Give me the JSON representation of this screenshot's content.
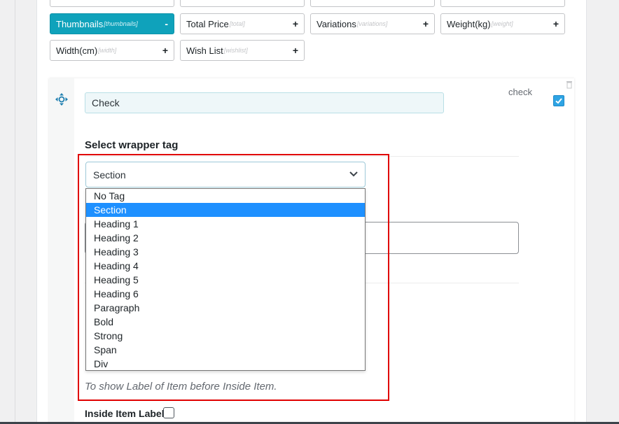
{
  "field_chips": [
    {
      "label": "Thumbnails",
      "key": "[thumbnails]",
      "action": "-",
      "active": true
    },
    {
      "label": "Total Price",
      "key": "[total]",
      "action": "+",
      "active": false
    },
    {
      "label": "Variations",
      "key": "[variations]",
      "action": "+",
      "active": false
    },
    {
      "label": "Weight(kg)",
      "key": "[weight]",
      "action": "+",
      "active": false
    },
    {
      "label": "Width(cm)",
      "key": "[width]",
      "action": "+",
      "active": false
    },
    {
      "label": "Wish List",
      "key": "[wishlist]",
      "action": "+",
      "active": false
    }
  ],
  "item": {
    "title_value": "Check",
    "type_label": "check",
    "enabled": true
  },
  "wrapper": {
    "heading": "Select wrapper tag",
    "selected": "Section",
    "options": [
      "No Tag",
      "Section",
      "Heading 1",
      "Heading 2",
      "Heading 3",
      "Heading 4",
      "Heading 5",
      "Heading 6",
      "Paragraph",
      "Bold",
      "Strong",
      "Span",
      "Div"
    ],
    "selected_index": 1,
    "help_text": "To show Label of Item before Inside Item."
  },
  "inside_item_label": {
    "label": "Inside Item Label",
    "checked": false
  },
  "colors": {
    "accent": "#0fa2bb",
    "highlight": "#e00000",
    "selection": "#1e90ff"
  }
}
